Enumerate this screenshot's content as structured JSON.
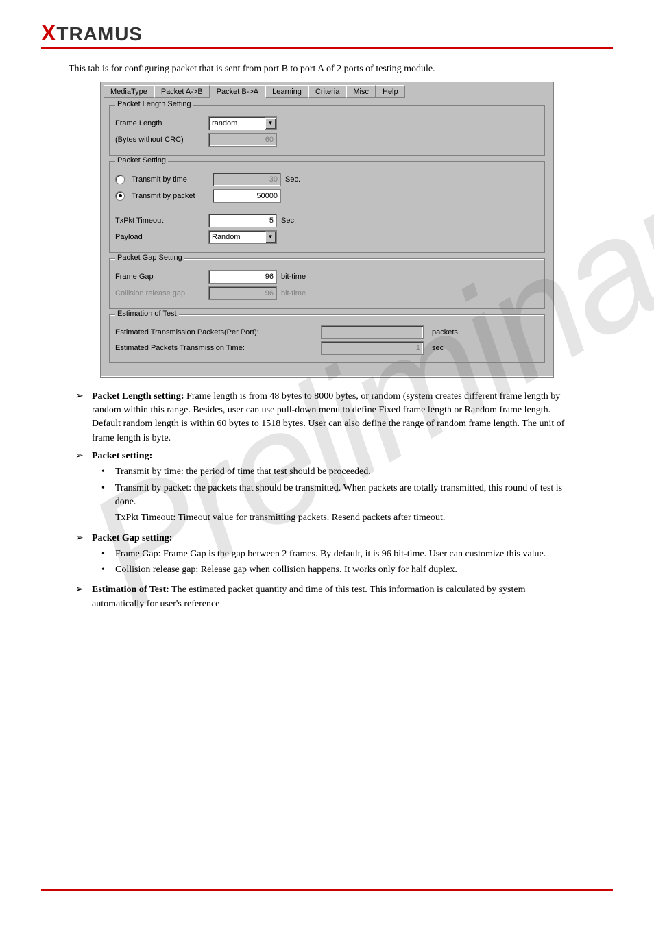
{
  "watermark": "Preliminary",
  "logo": {
    "x": "X",
    "rest": "TRAMUS"
  },
  "intro": "This tab is for configuring packet that is sent from port B to port A of 2 ports of testing module.",
  "dialog": {
    "tabs": [
      "MediaType",
      "Packet A->B",
      "Packet B->A",
      "Learning",
      "Criteria",
      "Misc",
      "Help"
    ],
    "active_tab_index": 2,
    "group_pls": {
      "legend": "Packet Length Setting",
      "frame_length_label": "Frame Length",
      "frame_length_value": "random",
      "bytes_label": "(Bytes without CRC)",
      "bytes_value": "60"
    },
    "group_ps": {
      "legend": "Packet Setting",
      "tx_time_label": "Transmit by time",
      "tx_time_value": "30",
      "tx_time_unit": "Sec.",
      "tx_pkt_label": "Transmit by packet",
      "tx_pkt_value": "50000",
      "txpkt_timeout_label": "TxPkt Timeout",
      "txpkt_timeout_value": "5",
      "txpkt_timeout_unit": "Sec.",
      "payload_label": "Payload",
      "payload_value": "Random"
    },
    "group_pg": {
      "legend": "Packet Gap Setting",
      "frame_gap_label": "Frame Gap",
      "frame_gap_value": "96",
      "frame_gap_unit": "bit-time",
      "collision_label": "Collision release gap",
      "collision_value": "96",
      "collision_unit": "bit-time"
    },
    "group_est": {
      "legend": "Estimation of Test",
      "r1_label": "Estimated Transmission Packets(Per Port):",
      "r1_value": "",
      "r1_unit": "packets",
      "r2_label": "Estimated Packets Transmission Time:",
      "r2_value": "1",
      "r2_unit": "sec"
    }
  },
  "desc": {
    "bullet_arrow": "➢",
    "bullet_dot": "•",
    "item1": {
      "title": "Packet Length setting:",
      "body": " Frame length is from 48 bytes to 8000 bytes, or random (system creates different frame length by random within this range. Besides, user can use pull-down menu to define Fixed frame length or Random frame length. Default random length is within 60 bytes to 1518 bytes. User can also define the range of random frame length. The unit of frame length is byte."
    },
    "item2": {
      "title": "Packet setting:",
      "sub1": "Transmit by time: the period of time that test should be proceeded.",
      "sub2": "Transmit by packet: the packets that should be transmitted. When packets are totally transmitted, this round of test is done.",
      "sub3": "TxPkt Timeout: Timeout value for transmitting packets. Resend packets after timeout."
    },
    "item3": {
      "title": "Packet Gap setting:",
      "sub1": "Frame Gap: Frame Gap is the gap between 2 frames. By default, it is 96 bit-time. User can customize this value.",
      "sub2": "Collision release gap: Release gap when collision happens. It works only for half duplex."
    },
    "item4": {
      "title": "Estimation of Test:",
      "body": " The estimated packet quantity and time of this test. This information is calculated by system automatically for user's reference"
    }
  }
}
